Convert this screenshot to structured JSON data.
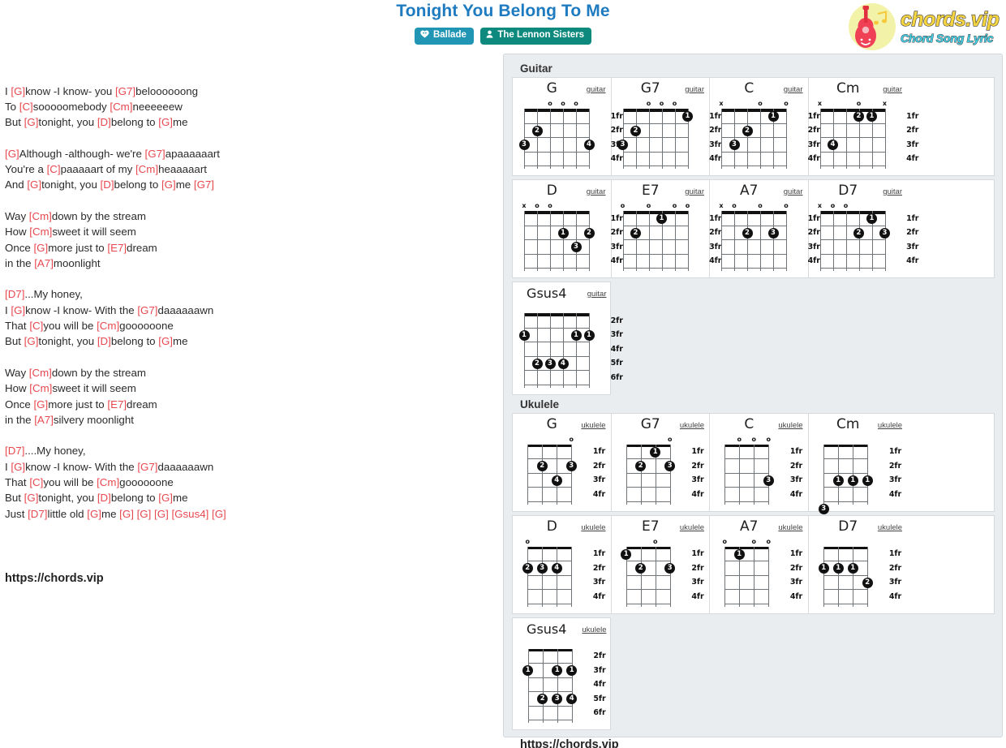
{
  "header": {
    "title": "Tonight You Belong To Me",
    "badges": [
      {
        "label": "Ballade",
        "icon": "music-heart-icon",
        "type": "genre"
      },
      {
        "label": "The Lennon Sisters",
        "icon": "person-icon",
        "type": "artist"
      }
    ],
    "logo": {
      "main": "chords.vip",
      "sub": "Chord Song Lyric",
      "icon": "guitar-icon"
    }
  },
  "lyrics": {
    "lines": [
      "I [G]know -I know- you [G7]beloooooong",
      "To [C]sooooomebody [Cm]neeeeeew",
      "But [G]tonight, you [D]belong to [G]me",
      "",
      "[G]Although -although- we're [G7]apaaaaaart",
      "You're a [C]paaaaart of my [Cm]heaaaaart",
      "And [G]tonight, you [D]belong to [G]me [G7]",
      "",
      "Way [Cm]down by the stream",
      "How [Cm]sweet it will seem",
      "Once [G]more just to [E7]dream",
      "in the [A7]moonlight",
      "",
      "[D7]...My honey,",
      "I [G]know -I know- With the [G7]daaaaaawn",
      "That [C]you will be [Cm]goooooone",
      "But [G]tonight, you [D]belong to [G]me",
      "",
      "Way [Cm]down by the stream",
      "How [Cm]sweet it will seem",
      "Once [G]more just to [E7]dream",
      "in the [A7]silvery moonlight",
      "",
      "[D7]....My honey,",
      "I [G]know -I know- With the [G7]daaaaaawn",
      "That [C]you will be [Cm]goooooone",
      "But [G]tonight, you [D]belong to [G]me",
      "Just [D7]little old [G]me [G] [G] [G] [Gsus4] [G]"
    ],
    "url": "https://chords.vip"
  },
  "colors": {
    "title": "#1f7bc0",
    "chord": "#e8484f",
    "badge_genre": "#2196b4",
    "badge_artist": "#0d8a7d",
    "panel_bg": "#e9edf0"
  },
  "panel": {
    "sections": [
      {
        "label": "Guitar",
        "instrument": "guitar",
        "strings": 6,
        "rows": [
          [
            {
              "name": "G",
              "instrument": "guitar",
              "fret_labels": [
                "1fr",
                "2fr",
                "3fr",
                "4fr"
              ],
              "top_marks": [
                "",
                "",
                "o",
                "o",
                "o",
                ""
              ],
              "dots": [
                {
                  "string": 5,
                  "fret": 2,
                  "finger": "2"
                },
                {
                  "string": 6,
                  "fret": 3,
                  "finger": "3"
                },
                {
                  "string": 1,
                  "fret": 3,
                  "finger": "4"
                }
              ]
            },
            {
              "name": "G7",
              "instrument": "guitar",
              "fret_labels": [
                "1fr",
                "2fr",
                "3fr",
                "4fr"
              ],
              "top_marks": [
                "",
                "",
                "o",
                "o",
                "o",
                ""
              ],
              "dots": [
                {
                  "string": 1,
                  "fret": 1,
                  "finger": "1"
                },
                {
                  "string": 5,
                  "fret": 2,
                  "finger": "2"
                },
                {
                  "string": 6,
                  "fret": 3,
                  "finger": "3"
                }
              ]
            },
            {
              "name": "C",
              "instrument": "guitar",
              "fret_labels": [
                "1fr",
                "2fr",
                "3fr",
                "4fr"
              ],
              "top_marks": [
                "x",
                "",
                "",
                "o",
                "",
                "o"
              ],
              "dots": [
                {
                  "string": 2,
                  "fret": 1,
                  "finger": "1"
                },
                {
                  "string": 4,
                  "fret": 2,
                  "finger": "2"
                },
                {
                  "string": 5,
                  "fret": 3,
                  "finger": "3"
                }
              ]
            },
            {
              "name": "Cm",
              "instrument": "guitar",
              "fret_labels": [
                "1fr",
                "2fr",
                "3fr",
                "4fr"
              ],
              "top_marks": [
                "x",
                "",
                "",
                "o",
                "",
                "x"
              ],
              "dots": [
                {
                  "string": 2,
                  "fret": 1,
                  "finger": "1"
                },
                {
                  "string": 3,
                  "fret": 1,
                  "finger": "2"
                },
                {
                  "string": 5,
                  "fret": 3,
                  "finger": "4"
                }
              ]
            }
          ],
          [
            {
              "name": "D",
              "instrument": "guitar",
              "fret_labels": [
                "1fr",
                "2fr",
                "3fr",
                "4fr"
              ],
              "top_marks": [
                "x",
                "o",
                "o",
                "",
                "",
                ""
              ],
              "dots": [
                {
                  "string": 3,
                  "fret": 2,
                  "finger": "1"
                },
                {
                  "string": 1,
                  "fret": 2,
                  "finger": "2"
                },
                {
                  "string": 2,
                  "fret": 3,
                  "finger": "3"
                }
              ]
            },
            {
              "name": "E7",
              "instrument": "guitar",
              "fret_labels": [
                "1fr",
                "2fr",
                "3fr",
                "4fr"
              ],
              "top_marks": [
                "o",
                "",
                "o",
                "",
                "o",
                "o"
              ],
              "dots": [
                {
                  "string": 3,
                  "fret": 1,
                  "finger": "1"
                },
                {
                  "string": 5,
                  "fret": 2,
                  "finger": "2"
                }
              ]
            },
            {
              "name": "A7",
              "instrument": "guitar",
              "fret_labels": [
                "1fr",
                "2fr",
                "3fr",
                "4fr"
              ],
              "top_marks": [
                "x",
                "o",
                "",
                "o",
                "",
                "o"
              ],
              "dots": [
                {
                  "string": 4,
                  "fret": 2,
                  "finger": "2"
                },
                {
                  "string": 2,
                  "fret": 2,
                  "finger": "3"
                }
              ]
            },
            {
              "name": "D7",
              "instrument": "guitar",
              "fret_labels": [
                "1fr",
                "2fr",
                "3fr",
                "4fr"
              ],
              "top_marks": [
                "x",
                "o",
                "o",
                "",
                "",
                ""
              ],
              "dots": [
                {
                  "string": 2,
                  "fret": 1,
                  "finger": "1"
                },
                {
                  "string": 3,
                  "fret": 2,
                  "finger": "2"
                },
                {
                  "string": 1,
                  "fret": 2,
                  "finger": "3"
                }
              ]
            }
          ],
          [
            {
              "name": "Gsus4",
              "instrument": "guitar",
              "fret_labels": [
                "2fr",
                "3fr",
                "4fr",
                "5fr",
                "6fr"
              ],
              "top_marks": [
                "",
                "",
                "",
                "",
                "",
                ""
              ],
              "dots": [
                {
                  "string": 6,
                  "fret": 2,
                  "finger": "1"
                },
                {
                  "string": 2,
                  "fret": 2,
                  "finger": "1"
                },
                {
                  "string": 1,
                  "fret": 2,
                  "finger": "1"
                },
                {
                  "string": 5,
                  "fret": 4,
                  "finger": "2"
                },
                {
                  "string": 4,
                  "fret": 4,
                  "finger": "3"
                },
                {
                  "string": 3,
                  "fret": 4,
                  "finger": "4"
                }
              ]
            }
          ]
        ]
      },
      {
        "label": "Ukulele",
        "instrument": "ukulele",
        "strings": 4,
        "rows": [
          [
            {
              "name": "G",
              "instrument": "ukulele",
              "fret_labels": [
                "1fr",
                "2fr",
                "3fr",
                "4fr"
              ],
              "top_marks": [
                "",
                "",
                "",
                "o"
              ],
              "dots": [
                {
                  "string": 3,
                  "fret": 2,
                  "finger": "2"
                },
                {
                  "string": 1,
                  "fret": 2,
                  "finger": "3"
                },
                {
                  "string": 2,
                  "fret": 3,
                  "finger": "4"
                }
              ]
            },
            {
              "name": "G7",
              "instrument": "ukulele",
              "fret_labels": [
                "1fr",
                "2fr",
                "3fr",
                "4fr"
              ],
              "top_marks": [
                "",
                "",
                "",
                "o"
              ],
              "dots": [
                {
                  "string": 2,
                  "fret": 1,
                  "finger": "1"
                },
                {
                  "string": 3,
                  "fret": 2,
                  "finger": "2"
                },
                {
                  "string": 1,
                  "fret": 2,
                  "finger": "3"
                }
              ]
            },
            {
              "name": "C",
              "instrument": "ukulele",
              "fret_labels": [
                "1fr",
                "2fr",
                "3fr",
                "4fr"
              ],
              "top_marks": [
                "",
                "o",
                "o",
                "o"
              ],
              "dots": [
                {
                  "string": 1,
                  "fret": 3,
                  "finger": "3"
                }
              ]
            },
            {
              "name": "Cm",
              "instrument": "ukulele",
              "fret_labels": [
                "1fr",
                "2fr",
                "3fr",
                "4fr"
              ],
              "top_marks": [
                "",
                "",
                "",
                ""
              ],
              "dots": [
                {
                  "string": 3,
                  "fret": 3,
                  "finger": "1"
                },
                {
                  "string": 2,
                  "fret": 3,
                  "finger": "1"
                },
                {
                  "string": 1,
                  "fret": 3,
                  "finger": "1"
                },
                {
                  "string": 4,
                  "fret": 5,
                  "finger": "3"
                }
              ]
            }
          ],
          [
            {
              "name": "D",
              "instrument": "ukulele",
              "fret_labels": [
                "1fr",
                "2fr",
                "3fr",
                "4fr"
              ],
              "top_marks": [
                "o",
                "",
                "",
                ""
              ],
              "dots": [
                {
                  "string": 4,
                  "fret": 2,
                  "finger": "2"
                },
                {
                  "string": 3,
                  "fret": 2,
                  "finger": "3"
                },
                {
                  "string": 2,
                  "fret": 2,
                  "finger": "4"
                }
              ]
            },
            {
              "name": "E7",
              "instrument": "ukulele",
              "fret_labels": [
                "1fr",
                "2fr",
                "3fr",
                "4fr"
              ],
              "top_marks": [
                "",
                "",
                "o",
                ""
              ],
              "dots": [
                {
                  "string": 4,
                  "fret": 1,
                  "finger": "1"
                },
                {
                  "string": 3,
                  "fret": 2,
                  "finger": "2"
                },
                {
                  "string": 1,
                  "fret": 2,
                  "finger": "3"
                }
              ]
            },
            {
              "name": "A7",
              "instrument": "ukulele",
              "fret_labels": [
                "1fr",
                "2fr",
                "3fr",
                "4fr"
              ],
              "top_marks": [
                "o",
                "",
                "o",
                "o"
              ],
              "dots": [
                {
                  "string": 3,
                  "fret": 1,
                  "finger": "1"
                }
              ]
            },
            {
              "name": "D7",
              "instrument": "ukulele",
              "fret_labels": [
                "1fr",
                "2fr",
                "3fr",
                "4fr"
              ],
              "top_marks": [
                "",
                "",
                "",
                ""
              ],
              "dots": [
                {
                  "string": 4,
                  "fret": 2,
                  "finger": "1"
                },
                {
                  "string": 3,
                  "fret": 2,
                  "finger": "1"
                },
                {
                  "string": 2,
                  "fret": 2,
                  "finger": "1"
                },
                {
                  "string": 1,
                  "fret": 3,
                  "finger": "2"
                }
              ]
            }
          ],
          [
            {
              "name": "Gsus4",
              "instrument": "ukulele",
              "fret_labels": [
                "2fr",
                "3fr",
                "4fr",
                "5fr",
                "6fr"
              ],
              "top_marks": [
                "",
                "",
                "",
                ""
              ],
              "dots": [
                {
                  "string": 4,
                  "fret": 2,
                  "finger": "1"
                },
                {
                  "string": 2,
                  "fret": 2,
                  "finger": "1"
                },
                {
                  "string": 1,
                  "fret": 2,
                  "finger": "1"
                },
                {
                  "string": 3,
                  "fret": 4,
                  "finger": "2"
                },
                {
                  "string": 2,
                  "fret": 4,
                  "finger": "3"
                },
                {
                  "string": 1,
                  "fret": 4,
                  "finger": "4"
                }
              ]
            }
          ]
        ]
      }
    ],
    "url": "https://chords.vip"
  }
}
